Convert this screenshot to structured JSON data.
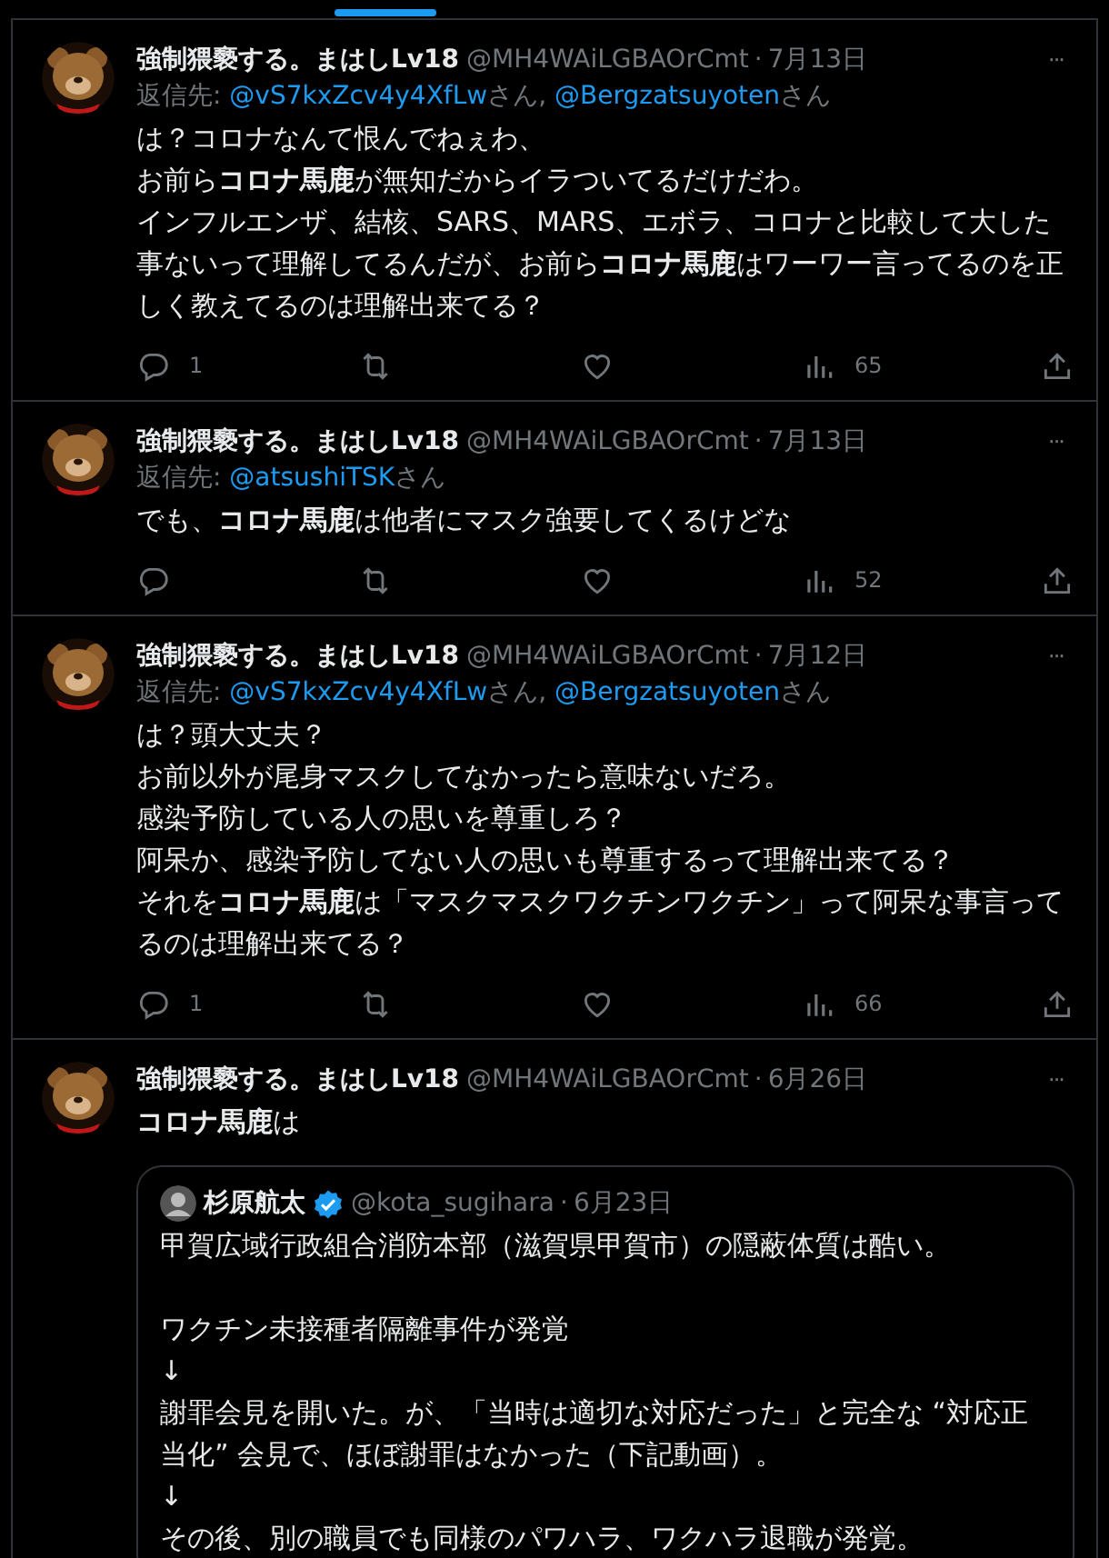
{
  "tweets": [
    {
      "name": "強制猥褻する。まはしLv18",
      "handle": "@MH4WAiLGBAOrCmt",
      "sep": "·",
      "date": "7月13日",
      "more": "···",
      "reply_to": {
        "label": "返信先:",
        "segments": [
          {
            "kind": "link",
            "text": "@vS7kxZcv4y4XfLw"
          },
          {
            "kind": "text",
            "text": "さん, "
          },
          {
            "kind": "link",
            "text": "@Bergzatsuyoten"
          },
          {
            "kind": "text",
            "text": "さん"
          }
        ]
      },
      "lines": [
        "は？コロナなんて恨んでねぇわ、",
        "お前ら**コロナ馬鹿**が無知だからイラついてるだけだわ。",
        "インフルエンザ、結核、SARS、MARS、エボラ、コロナと比較して大した事ないって理解してるんだが、お前ら**コロナ馬鹿**はワーワー言ってるのを正しく教えてるのは理解出来てる？"
      ],
      "actions": {
        "replies": "1",
        "views": "65"
      }
    },
    {
      "name": "強制猥褻する。まはしLv18",
      "handle": "@MH4WAiLGBAOrCmt",
      "sep": "·",
      "date": "7月13日",
      "more": "···",
      "reply_to": {
        "label": "返信先:",
        "segments": [
          {
            "kind": "link",
            "text": "@atsushiTSK"
          },
          {
            "kind": "text",
            "text": "さん"
          }
        ]
      },
      "lines": [
        "でも、**コロナ馬鹿**は他者にマスク強要してくるけどな"
      ],
      "actions": {
        "views": "52"
      }
    },
    {
      "name": "強制猥褻する。まはしLv18",
      "handle": "@MH4WAiLGBAOrCmt",
      "sep": "·",
      "date": "7月12日",
      "more": "···",
      "reply_to": {
        "label": "返信先:",
        "segments": [
          {
            "kind": "link",
            "text": "@vS7kxZcv4y4XfLw"
          },
          {
            "kind": "text",
            "text": "さん, "
          },
          {
            "kind": "link",
            "text": "@Bergzatsuyoten"
          },
          {
            "kind": "text",
            "text": "さん"
          }
        ]
      },
      "lines": [
        "は？頭大丈夫？",
        "お前以外が尾身マスクしてなかったら意味ないだろ。",
        "感染予防している人の思いを尊重しろ？",
        "阿呆か、感染予防してない人の思いも尊重するって理解出来てる？",
        "それを**コロナ馬鹿**は「マスクマスクワクチンワクチン」って阿呆な事言ってるのは理解出来てる？"
      ],
      "actions": {
        "replies": "1",
        "views": "66"
      }
    },
    {
      "name": "強制猥褻する。まはしLv18",
      "handle": "@MH4WAiLGBAOrCmt",
      "sep": "·",
      "date": "6月26日",
      "more": "···",
      "lines": [
        "**コロナ馬鹿**は"
      ],
      "quote": {
        "name": "杉原航太",
        "verified": true,
        "handle": "@kota_sugihara",
        "sep": "·",
        "date": "6月23日",
        "paragraphs": [
          [
            "甲賀広域行政組合消防本部（滋賀県甲賀市）の隠蔽体質は酷い。"
          ],
          [
            "ワクチン未接種者隔離事件が発覚",
            "↓",
            "謝罪会見を開いた。が、「当時は適切な対応だった」と完全な “対応正当化” 会見で、ほぼ謝罪はなかった（下記動画）。",
            "↓",
            "その後、別の職員でも同様のパワハラ、ワクハラ退職が発覚。"
          ]
        ]
      }
    }
  ]
}
